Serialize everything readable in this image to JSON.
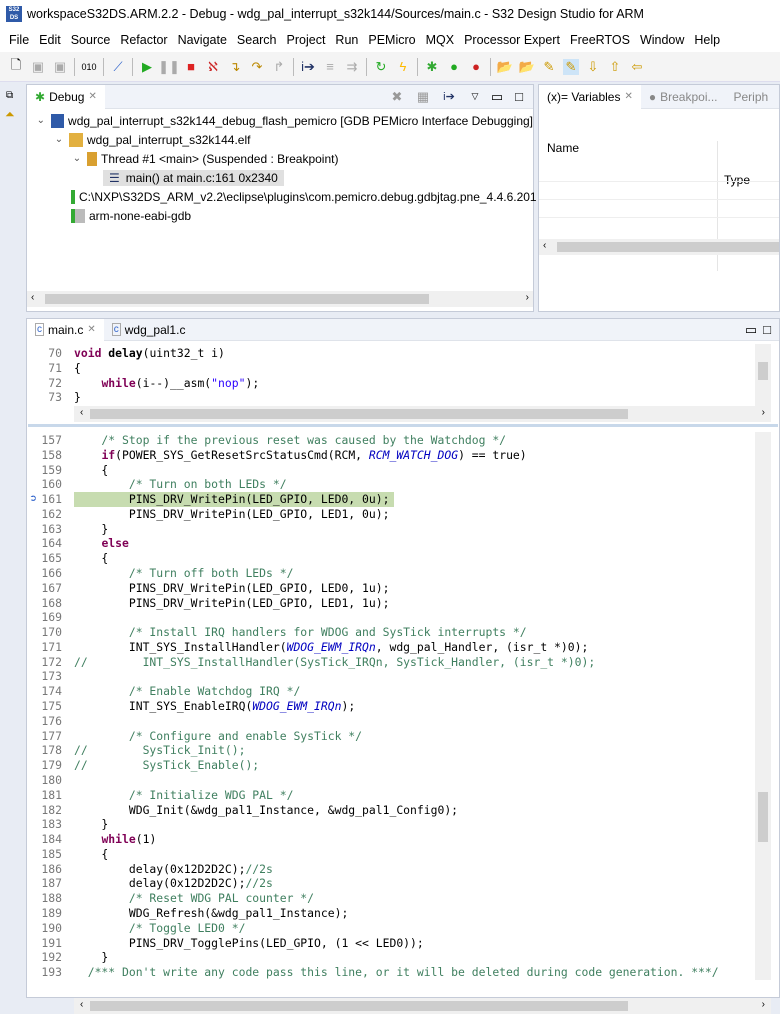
{
  "window": {
    "title": "workspaceS32DS.ARM.2.2 - Debug - wdg_pal_interrupt_s32k144/Sources/main.c - S32 Design Studio for ARM",
    "logo": "S32 DS"
  },
  "menu": [
    "File",
    "Edit",
    "Source",
    "Refactor",
    "Navigate",
    "Search",
    "Project",
    "Run",
    "PEMicro",
    "MQX",
    "Processor Expert",
    "FreeRTOS",
    "Window",
    "Help"
  ],
  "debug": {
    "tab": "Debug",
    "tree": [
      {
        "label": "wdg_pal_interrupt_s32k144_debug_flash_pemicro [GDB PEMicro Interface Debugging]"
      },
      {
        "label": "wdg_pal_interrupt_s32k144.elf"
      },
      {
        "label": "Thread #1 <main> (Suspended : Breakpoint)"
      },
      {
        "label": "main() at main.c:161 0x2340"
      },
      {
        "label": "C:\\NXP\\S32DS_ARM_v2.2\\eclipse\\plugins\\com.pemicro.debug.gdbjtag.pne_4.4.6.201"
      },
      {
        "label": "arm-none-eabi-gdb"
      }
    ]
  },
  "variables": {
    "tabs": [
      "(x)= Variables",
      "Breakpoi...",
      "Periph"
    ],
    "columns": [
      "Name",
      "Type"
    ]
  },
  "editor": {
    "tabs": [
      "main.c",
      "wdg_pal1.c"
    ],
    "top": [
      {
        "n": "70",
        "seg": [
          [
            "k",
            "void"
          ],
          [
            "n",
            " "
          ],
          [
            "f",
            "delay"
          ],
          [
            "n",
            "(uint32_t i)"
          ]
        ]
      },
      {
        "n": "71",
        "seg": [
          [
            "n",
            "{"
          ]
        ]
      },
      {
        "n": "72",
        "seg": [
          [
            "n",
            "    "
          ],
          [
            "k",
            "while"
          ],
          [
            "n",
            "(i--)__asm("
          ],
          [
            "s",
            "\"nop\""
          ],
          [
            "n",
            ");"
          ]
        ]
      },
      {
        "n": "73",
        "seg": [
          [
            "n",
            "}"
          ]
        ]
      }
    ],
    "main": [
      {
        "n": "157",
        "seg": [
          [
            "c",
            "    /* Stop if the previous reset was caused by the Watchdog */"
          ]
        ]
      },
      {
        "n": "158",
        "seg": [
          [
            "n",
            "    "
          ],
          [
            "k",
            "if"
          ],
          [
            "n",
            "(POWER_SYS_GetResetSrcStatusCmd(RCM, "
          ],
          [
            "m",
            "RCM_WATCH_DOG"
          ],
          [
            "n",
            ") == true)"
          ]
        ]
      },
      {
        "n": "159",
        "seg": [
          [
            "n",
            "    {"
          ]
        ]
      },
      {
        "n": "160",
        "seg": [
          [
            "c",
            "        /* Turn on both LEDs */"
          ]
        ]
      },
      {
        "n": "161",
        "seg": [
          [
            "n",
            "        PINS_DRV_WritePin(LED_GPIO, LED0, 0u);"
          ]
        ]
      },
      {
        "n": "162",
        "seg": [
          [
            "n",
            "        PINS_DRV_WritePin(LED_GPIO, LED1, 0u);"
          ]
        ]
      },
      {
        "n": "163",
        "seg": [
          [
            "n",
            "    }"
          ]
        ]
      },
      {
        "n": "164",
        "seg": [
          [
            "n",
            "    "
          ],
          [
            "k",
            "else"
          ]
        ]
      },
      {
        "n": "165",
        "seg": [
          [
            "n",
            "    {"
          ]
        ]
      },
      {
        "n": "166",
        "seg": [
          [
            "c",
            "        /* Turn off both LEDs */"
          ]
        ]
      },
      {
        "n": "167",
        "seg": [
          [
            "n",
            "        PINS_DRV_WritePin(LED_GPIO, LED0, 1u);"
          ]
        ]
      },
      {
        "n": "168",
        "seg": [
          [
            "n",
            "        PINS_DRV_WritePin(LED_GPIO, LED1, 1u);"
          ]
        ]
      },
      {
        "n": "169",
        "seg": []
      },
      {
        "n": "170",
        "seg": [
          [
            "c",
            "        /* Install IRQ handlers for WDOG and SysTick interrupts */"
          ]
        ]
      },
      {
        "n": "171",
        "seg": [
          [
            "n",
            "        INT_SYS_InstallHandler("
          ],
          [
            "m",
            "WDOG_EWM_IRQn"
          ],
          [
            "n",
            ", wdg_pal_Handler, (isr_t *)0);"
          ]
        ]
      },
      {
        "n": "172",
        "seg": [
          [
            "c",
            "//        INT_SYS_InstallHandler(SysTick_IRQn, SysTick_Handler, (isr_t *)0);"
          ]
        ]
      },
      {
        "n": "173",
        "seg": []
      },
      {
        "n": "174",
        "seg": [
          [
            "c",
            "        /* Enable Watchdog IRQ */"
          ]
        ]
      },
      {
        "n": "175",
        "seg": [
          [
            "n",
            "        INT_SYS_EnableIRQ("
          ],
          [
            "m",
            "WDOG_EWM_IRQn"
          ],
          [
            "n",
            ");"
          ]
        ]
      },
      {
        "n": "176",
        "seg": []
      },
      {
        "n": "177",
        "seg": [
          [
            "c",
            "        /* Configure and enable SysTick */"
          ]
        ]
      },
      {
        "n": "178",
        "seg": [
          [
            "c",
            "//        SysTick_Init();"
          ]
        ]
      },
      {
        "n": "179",
        "seg": [
          [
            "c",
            "//        SysTick_Enable();"
          ]
        ]
      },
      {
        "n": "180",
        "seg": []
      },
      {
        "n": "181",
        "seg": [
          [
            "c",
            "        /* Initialize WDG PAL */"
          ]
        ]
      },
      {
        "n": "182",
        "seg": [
          [
            "n",
            "        WDG_Init(&wdg_pal1_Instance, &wdg_pal1_Config0);"
          ]
        ]
      },
      {
        "n": "183",
        "seg": [
          [
            "n",
            "    }"
          ]
        ]
      },
      {
        "n": "184",
        "seg": [
          [
            "n",
            "    "
          ],
          [
            "k",
            "while"
          ],
          [
            "n",
            "(1)"
          ]
        ]
      },
      {
        "n": "185",
        "seg": [
          [
            "n",
            "    {"
          ]
        ]
      },
      {
        "n": "186",
        "seg": [
          [
            "n",
            "        delay(0x12D2D2C);"
          ],
          [
            "c",
            "//2s"
          ]
        ]
      },
      {
        "n": "187",
        "seg": [
          [
            "n",
            "        delay(0x12D2D2C);"
          ],
          [
            "c",
            "//2s"
          ]
        ]
      },
      {
        "n": "188",
        "seg": [
          [
            "c",
            "        /* Reset WDG PAL counter */"
          ]
        ]
      },
      {
        "n": "189",
        "seg": [
          [
            "n",
            "        WDG_Refresh(&wdg_pal1_Instance);"
          ]
        ]
      },
      {
        "n": "190",
        "seg": [
          [
            "c",
            "        /* Toggle LED0 */"
          ]
        ]
      },
      {
        "n": "191",
        "seg": [
          [
            "n",
            "        PINS_DRV_TogglePins(LED_GPIO, (1 << LED0));"
          ]
        ]
      },
      {
        "n": "192",
        "seg": [
          [
            "n",
            "    }"
          ]
        ]
      },
      {
        "n": "193",
        "seg": [
          [
            "c",
            "  /*** Don't write any code pass this line, or it will be deleted during code generation. ***/"
          ]
        ]
      }
    ],
    "current_line": "161"
  }
}
